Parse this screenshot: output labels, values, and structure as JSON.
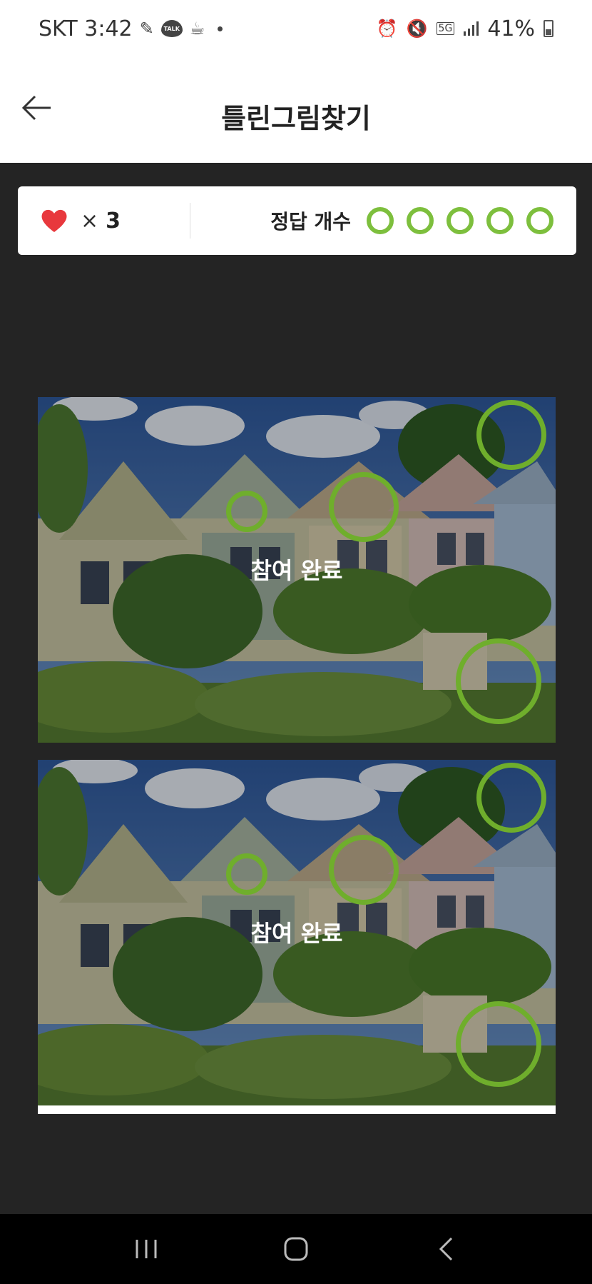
{
  "status_bar": {
    "carrier_time": "SKT 3:42",
    "talk_label": "TALK",
    "network": "5G",
    "battery": "41%"
  },
  "header": {
    "title": "틀린그림찾기"
  },
  "score": {
    "lives_symbol": "×",
    "lives_count": "3",
    "answers_label": "정답 개수",
    "answers_found": 5,
    "answers_total": 5
  },
  "pictures": [
    {
      "status": "참여 완료"
    },
    {
      "status": "참여 완료"
    }
  ],
  "colors": {
    "accent_green": "#7dbf3d",
    "heart_red": "#e8383d",
    "background": "#242424"
  }
}
